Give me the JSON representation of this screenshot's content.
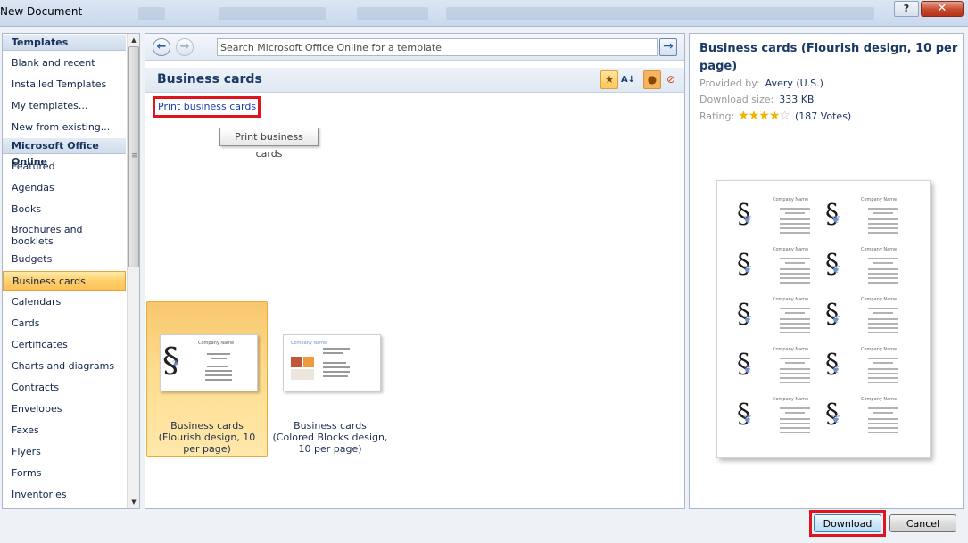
{
  "window": {
    "title": "New Document",
    "help_label": "?",
    "close_label": "✕"
  },
  "sidebar": {
    "templates_header": "Templates",
    "local_items": [
      {
        "label": "Blank and recent"
      },
      {
        "label": "Installed Templates"
      },
      {
        "label": "My templates..."
      },
      {
        "label": "New from existing..."
      }
    ],
    "online_header": "Microsoft Office Online",
    "online_items": [
      {
        "label": "Featured"
      },
      {
        "label": "Agendas"
      },
      {
        "label": "Books"
      },
      {
        "label": "Brochures and booklets"
      },
      {
        "label": "Budgets"
      },
      {
        "label": "Business cards",
        "selected": true
      },
      {
        "label": "Calendars"
      },
      {
        "label": "Cards"
      },
      {
        "label": "Certificates"
      },
      {
        "label": "Charts and diagrams"
      },
      {
        "label": "Contracts"
      },
      {
        "label": "Envelopes"
      },
      {
        "label": "Faxes"
      },
      {
        "label": "Flyers"
      },
      {
        "label": "Forms"
      },
      {
        "label": "Inventories"
      }
    ]
  },
  "search": {
    "placeholder": "Search Microsoft Office Online for a template",
    "back_icon": "back-arrow-icon",
    "forward_icon": "forward-arrow-icon",
    "go_icon": "go-arrow-icon"
  },
  "section": {
    "title": "Business cards",
    "print_link": "Print business cards",
    "tooltip": "Print business cards"
  },
  "templates": [
    {
      "label": "Business cards (Flourish design, 10 per page)",
      "selected": true,
      "thumb_company": "Company Name"
    },
    {
      "label": "Business cards (Colored Blocks design, 10 per page)",
      "selected": false,
      "thumb_company": "Company Name"
    }
  ],
  "details": {
    "title": "Business cards (Flourish design, 10 per page)",
    "provided_by_label": "Provided by:",
    "provided_by": "Avery (U.S.)",
    "download_size_label": "Download size:",
    "download_size": "333 KB",
    "rating_label": "Rating:",
    "rating_stars": 4,
    "rating_max": 5,
    "votes": "(187 Votes)",
    "preview_company": "Company Name"
  },
  "buttons": {
    "download": "Download",
    "cancel": "Cancel"
  },
  "colors": {
    "selection": "#ffcf6a",
    "highlight_outline": "#e0141e",
    "link": "#1a3fb0",
    "heading": "#1b3a66"
  }
}
